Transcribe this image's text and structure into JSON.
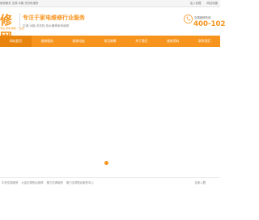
{
  "topbar": {
    "left_text": "维修服务 空调 冰箱 洗衣机维修",
    "right_links": [
      "加入收藏",
      "网站地图"
    ]
  },
  "logo": {
    "text": "修网",
    "subtitle": "专注·家电·维修·一站式"
  },
  "header": {
    "slogan": "专注于家电维修行业服务",
    "sub_slogan": "空调,冰箱,洗衣机,热水器等家电维修"
  },
  "hotline": {
    "label": "空调维修热线",
    "number": "400-102"
  },
  "nav": {
    "items": [
      {
        "label": "网站首页"
      },
      {
        "label": "维修服务"
      },
      {
        "label": "维修动态"
      },
      {
        "label": "常见故障"
      },
      {
        "label": "关于我们"
      },
      {
        "label": "维修资料"
      },
      {
        "label": "联系我们"
      }
    ]
  },
  "footer": {
    "links": [
      "中央空调维修",
      "大金空调售后维修",
      "格力空调维修",
      "格力空调售后服务中心"
    ],
    "favorite": "加收入藏"
  },
  "colors": {
    "brand": "#f7941d",
    "nav_active": "#e8830e"
  }
}
